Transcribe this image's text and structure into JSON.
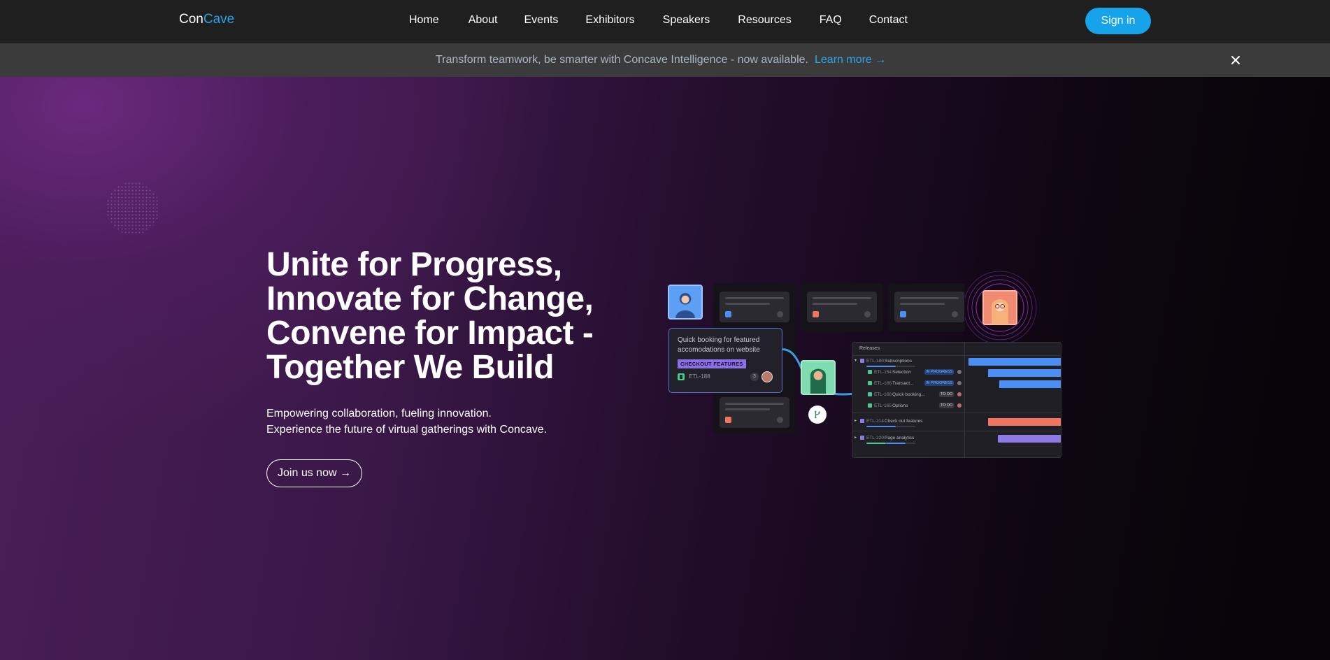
{
  "nav": {
    "logo_prefix": "Con",
    "logo_accent": "Cave",
    "links": [
      "Home",
      "About",
      "Events",
      "Exhibitors",
      "Speakers",
      "Resources",
      "FAQ",
      "Contact"
    ],
    "signin_label": "Sign in"
  },
  "banner": {
    "text": "Transform teamwork, be smarter with Concave Intelligence - now available.",
    "link_label": "Learn more →",
    "close_icon": "close-icon"
  },
  "hero": {
    "headline": [
      "Unite for Progress,",
      "Innovate for Change,",
      "Convene for Impact -",
      "Together We Build"
    ],
    "subtext": [
      "Empowering collaboration, fueling innovation.",
      "Experience the future of virtual gatherings with Concave."
    ],
    "cta_label": "Join us now →"
  },
  "illustration": {
    "task_card": {
      "title": "Quick booking for featured accomodations on website",
      "tag": "CHECKOUT FEATURES",
      "id": "ETL-188",
      "count": "3"
    },
    "releases": {
      "title": "Releases",
      "rows": [
        {
          "id": "ETL-180",
          "label": "Subscriptions",
          "badge": ""
        },
        {
          "id": "ETL-154",
          "label": "Selection",
          "badge": "IN PROGRESS"
        },
        {
          "id": "ETL-166",
          "label": "Transact...",
          "badge": "IN PROGRESS"
        },
        {
          "id": "ETL-168",
          "label": "Quick booking...",
          "badge": "TO DO"
        },
        {
          "id": "ETL-165",
          "label": "Options",
          "badge": "TO DO"
        },
        {
          "id": "ETL-214",
          "label": "Check out features",
          "badge": ""
        },
        {
          "id": "ETL-220",
          "label": "Page analytics",
          "badge": ""
        }
      ]
    },
    "colors": {
      "blue": "#4b8ef5",
      "orange": "#ef7560",
      "purple": "#8f7be6",
      "green": "#4bc88c"
    }
  }
}
